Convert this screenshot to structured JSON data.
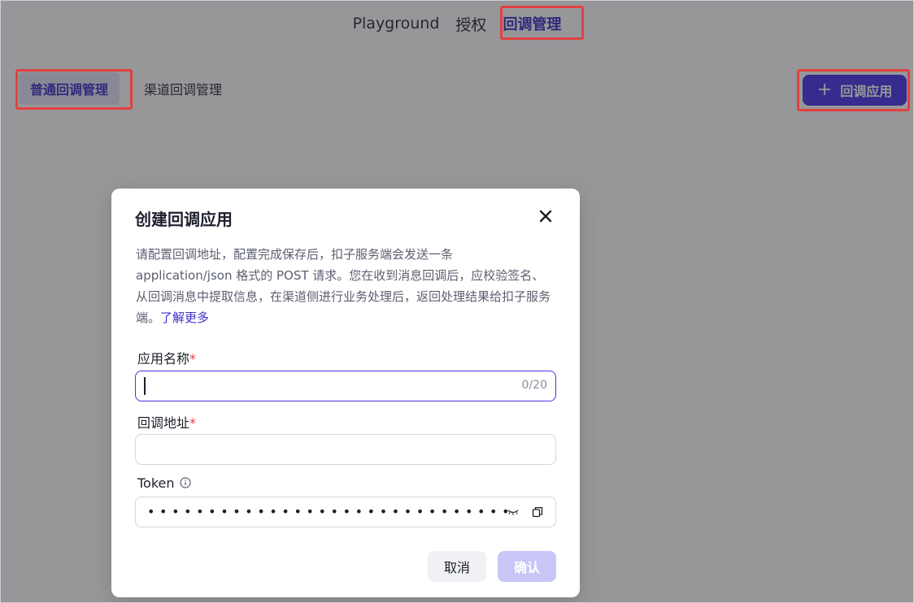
{
  "nav": {
    "items": [
      {
        "label": "Playground"
      },
      {
        "label": "授权"
      },
      {
        "label": "回调管理"
      }
    ],
    "active_index": 2
  },
  "subtabs": {
    "items": [
      {
        "label": "普通回调管理"
      },
      {
        "label": "渠道回调管理"
      }
    ]
  },
  "toolbar": {
    "add_button_icon": "+",
    "add_button_label": "回调应用"
  },
  "modal": {
    "title": "创建回调应用",
    "description": "请配置回调地址，配置完成保存后，扣子服务端会发送一条 application/json 格式的 POST 请求。您在收到消息回调后，应校验签名、从回调消息中提取信息，在渠道侧进行业务处理后，返回处理结果给扣子服务端。",
    "learn_more": "了解更多",
    "fields": {
      "app_name": {
        "label": "应用名称",
        "required_mark": "*",
        "value": "",
        "counter": "0/20"
      },
      "callback_url": {
        "label": "回调地址",
        "required_mark": "*",
        "value": ""
      },
      "token": {
        "label": "Token",
        "masked_value": "••••••••••••••••••••••••••••••"
      }
    },
    "cancel_label": "取消",
    "confirm_label": "确认"
  },
  "colors": {
    "accent": "#4636e8",
    "highlight": "#e34141",
    "overlay": "#222226"
  }
}
